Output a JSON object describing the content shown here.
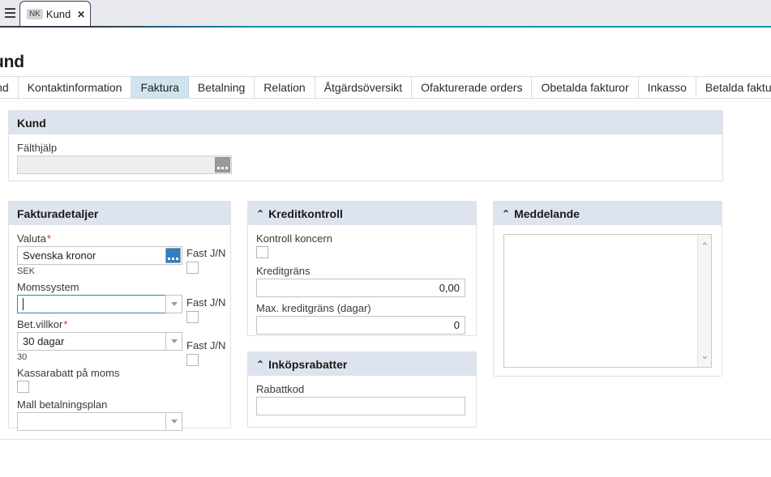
{
  "browser": {
    "menu_icon": "hamburger-icon",
    "tab": {
      "badge": "NK",
      "title": "Kund",
      "close": "✕"
    }
  },
  "page": {
    "title": "und"
  },
  "tabs": [
    {
      "label": "Kund",
      "active": false
    },
    {
      "label": "Kontaktinformation",
      "active": false
    },
    {
      "label": "Faktura",
      "active": true
    },
    {
      "label": "Betalning",
      "active": false
    },
    {
      "label": "Relation",
      "active": false
    },
    {
      "label": "Åtgärdsöversikt",
      "active": false
    },
    {
      "label": "Ofakturerade orders",
      "active": false
    },
    {
      "label": "Obetalda fakturor",
      "active": false
    },
    {
      "label": "Inkasso",
      "active": false
    },
    {
      "label": "Betalda fakturor",
      "active": false
    }
  ],
  "kund_panel": {
    "heading": "Kund",
    "falthjalp": {
      "label": "Fälthjälp",
      "value": "",
      "browse_icon": "ellipsis-browse-icon"
    }
  },
  "fakturadetaljer": {
    "heading": "Fakturadetaljer",
    "valuta": {
      "label": "Valuta",
      "required": "*",
      "value": "Svenska kronor",
      "sub_value": "SEK",
      "browse_icon": "ellipsis-browse-icon",
      "fast_label": "Fast J/N",
      "fast_checked": false
    },
    "momssystem": {
      "label": "Momssystem",
      "value": "",
      "focused": true,
      "arrow_icon": "chevron-down-icon",
      "fast_label": "Fast J/N",
      "fast_checked": false
    },
    "bet_villkor": {
      "label": "Bet.villkor",
      "required": "*",
      "value": "30 dagar",
      "sub_value": "30",
      "arrow_icon": "chevron-down-icon",
      "fast_label": "Fast J/N",
      "fast_checked": false
    },
    "kassarabatt": {
      "label": "Kassarabatt på moms",
      "checked": false
    },
    "mall_betalningsplan": {
      "label": "Mall betalningsplan",
      "value": "",
      "arrow_icon": "chevron-down-icon"
    }
  },
  "kreditkontroll": {
    "heading": "Kreditkontroll",
    "collapse_icon": "⌃",
    "kontroll_koncern": {
      "label": "Kontroll koncern",
      "checked": false
    },
    "kreditgrans": {
      "label": "Kreditgräns",
      "value": "0,00"
    },
    "max_kreditgrans": {
      "label": "Max. kreditgräns (dagar)",
      "value": "0"
    }
  },
  "inkopsrabatter": {
    "heading": "Inköpsrabatter",
    "collapse_icon": "⌃",
    "rabattkod": {
      "label": "Rabattkod",
      "value": ""
    }
  },
  "meddelande": {
    "heading": "Meddelande",
    "collapse_icon": "⌃",
    "text": "",
    "scroll_up_icon": "⌃",
    "scroll_down_icon": "⌄"
  },
  "colors": {
    "accent_teal": "#0e9bae",
    "tab_active_bg": "#cfe4ef",
    "panel_head_bg": "#dde3ef",
    "required_red": "#c0392b",
    "focus_border": "#2d8a9e",
    "browse_blue": "#2e7fc4"
  }
}
